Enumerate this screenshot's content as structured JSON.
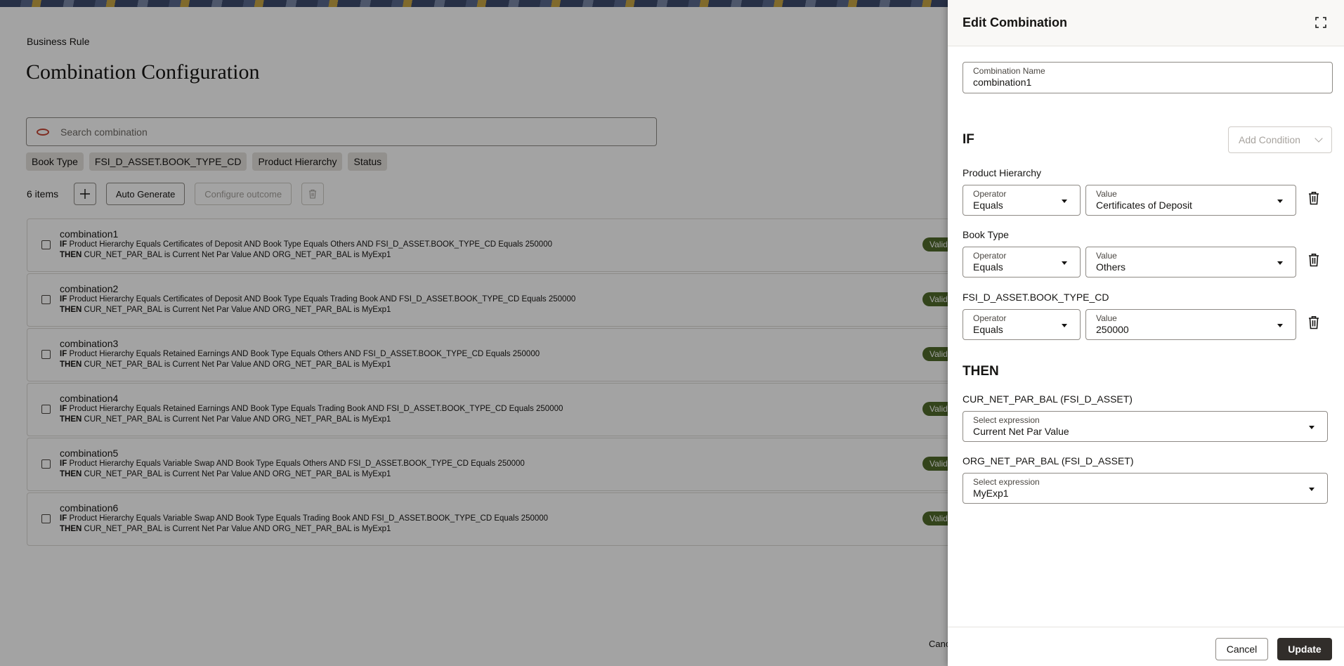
{
  "page": {
    "breadcrumb": "Business Rule",
    "title": "Combination Configuration",
    "search_placeholder": "Search combination",
    "chips": [
      "Book Type",
      "FSI_D_ASSET.BOOK_TYPE_CD",
      "Product Hierarchy",
      "Status"
    ],
    "item_count": "6 items",
    "auto_generate_label": "Auto Generate",
    "configure_outcome_label": "Configure outcome",
    "if_keyword": "IF",
    "then_keyword": "THEN",
    "valid_label": "Valid",
    "cancel_label": "Canc",
    "combinations": [
      {
        "name": "combination1",
        "if": "Product Hierarchy Equals Certificates of Deposit AND Book Type Equals Others AND FSI_D_ASSET.BOOK_TYPE_CD Equals 250000",
        "then": "CUR_NET_PAR_BAL is Current Net Par Value AND ORG_NET_PAR_BAL is MyExp1"
      },
      {
        "name": "combination2",
        "if": "Product Hierarchy Equals Certificates of Deposit AND Book Type Equals Trading Book AND FSI_D_ASSET.BOOK_TYPE_CD Equals 250000",
        "then": "CUR_NET_PAR_BAL is Current Net Par Value AND ORG_NET_PAR_BAL is MyExp1"
      },
      {
        "name": "combination3",
        "if": "Product Hierarchy Equals Retained Earnings AND Book Type Equals Others AND FSI_D_ASSET.BOOK_TYPE_CD Equals 250000",
        "then": "CUR_NET_PAR_BAL is Current Net Par Value AND ORG_NET_PAR_BAL is MyExp1"
      },
      {
        "name": "combination4",
        "if": "Product Hierarchy Equals Retained Earnings AND Book Type Equals Trading Book AND FSI_D_ASSET.BOOK_TYPE_CD Equals 250000",
        "then": "CUR_NET_PAR_BAL is Current Net Par Value AND ORG_NET_PAR_BAL is MyExp1"
      },
      {
        "name": "combination5",
        "if": "Product Hierarchy Equals Variable Swap AND Book Type Equals Others AND FSI_D_ASSET.BOOK_TYPE_CD Equals 250000",
        "then": "CUR_NET_PAR_BAL is Current Net Par Value AND ORG_NET_PAR_BAL is MyExp1"
      },
      {
        "name": "combination6",
        "if": "Product Hierarchy Equals Variable Swap AND Book Type Equals Trading Book AND FSI_D_ASSET.BOOK_TYPE_CD Equals 250000",
        "then": "CUR_NET_PAR_BAL is Current Net Par Value AND ORG_NET_PAR_BAL is MyExp1"
      }
    ]
  },
  "drawer": {
    "title": "Edit Combination",
    "name_label": "Combination Name",
    "name_value": "combination1",
    "if_heading": "IF",
    "add_condition_label": "Add Condition",
    "operator_label": "Operator",
    "value_label": "Value",
    "conditions": [
      {
        "field": "Product Hierarchy",
        "operator": "Equals",
        "value": "Certificates of Deposit"
      },
      {
        "field": "Book Type",
        "operator": "Equals",
        "value": "Others"
      },
      {
        "field": "FSI_D_ASSET.BOOK_TYPE_CD",
        "operator": "Equals",
        "value": "250000"
      }
    ],
    "then_heading": "THEN",
    "expression_label": "Select expression",
    "outcomes": [
      {
        "target": "CUR_NET_PAR_BAL (FSI_D_ASSET)",
        "expression": "Current Net Par Value"
      },
      {
        "target": "ORG_NET_PAR_BAL (FSI_D_ASSET)",
        "expression": "MyExp1"
      }
    ],
    "cancel_label": "Cancel",
    "update_label": "Update"
  },
  "icons": {
    "search": "oracle-oval-icon",
    "add": "plus-icon",
    "delete": "trash-icon",
    "expand": "expand-icon",
    "dropdown": "caret-down-icon",
    "add_condition": "chevron-down-icon"
  },
  "colors": {
    "valid_badge": "#506b2b",
    "update_button": "#312d2a",
    "search_icon": "#c74634"
  }
}
